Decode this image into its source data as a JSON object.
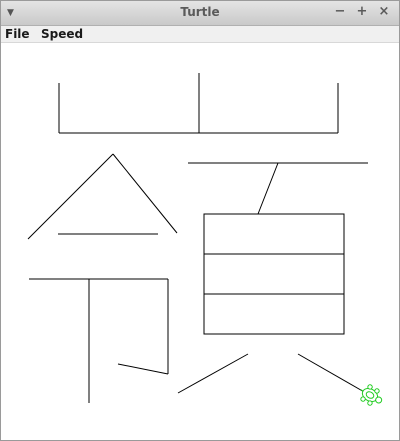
{
  "window": {
    "title": "Turtle"
  },
  "titlebar": {
    "minimize_glyph": "−",
    "maximize_glyph": "+",
    "close_glyph": "×",
    "menu_glyph": "▼"
  },
  "menubar": {
    "items": [
      {
        "label": "File"
      },
      {
        "label": "Speed"
      }
    ]
  },
  "colors": {
    "stroke": "#000000",
    "turtle": "#22cc22"
  }
}
